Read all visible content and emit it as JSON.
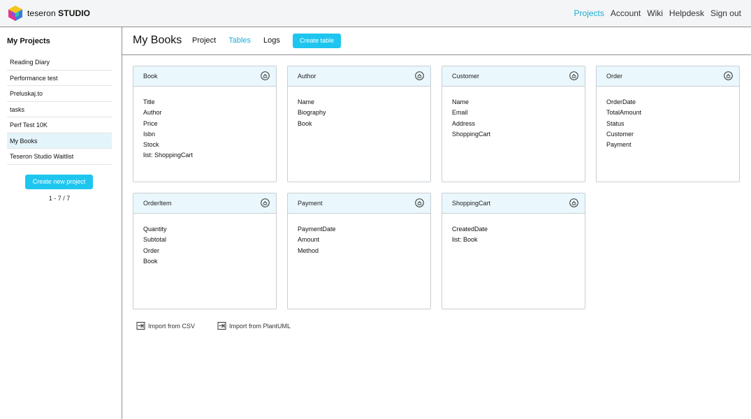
{
  "header": {
    "brand_light": "teseron",
    "brand_bold": "STUDIO",
    "nav": [
      "Projects",
      "Account",
      "Wiki",
      "Helpdesk",
      "Sign out"
    ]
  },
  "sidebar": {
    "title": "My Projects",
    "projects": [
      "Reading Diary",
      "Performance test",
      "Preluskaj.to",
      "tasks",
      "Perf Test 10K",
      "My Books",
      "Teseron Studio Waitlist"
    ],
    "selected": "My Books",
    "create_label": "Create new project",
    "pager": "1 - 7 / 7"
  },
  "main": {
    "title": "My Books",
    "tabs": [
      "Project",
      "Tables",
      "Logs"
    ],
    "active_tab": "Tables",
    "create_table_label": "Create table",
    "tables": [
      {
        "name": "Book",
        "fields": [
          "Title",
          "Author",
          "Price",
          "Isbn",
          "Stock",
          "list: ShoppingCart"
        ]
      },
      {
        "name": "Author",
        "fields": [
          "Name",
          "Biography",
          "Book"
        ]
      },
      {
        "name": "Customer",
        "fields": [
          "Name",
          "Email",
          "Address",
          "ShoppingCart"
        ]
      },
      {
        "name": "Order",
        "fields": [
          "OrderDate",
          "TotalAmount",
          "Status",
          "Customer",
          "Payment"
        ]
      },
      {
        "name": "OrderItem",
        "fields": [
          "Quantity",
          "Subtotal",
          "Order",
          "Book"
        ]
      },
      {
        "name": "Payment",
        "fields": [
          "PaymentDate",
          "Amount",
          "Method"
        ]
      },
      {
        "name": "ShoppingCart",
        "fields": [
          "CreatedDate",
          "list: Book"
        ]
      }
    ],
    "import_csv": "Import from CSV",
    "import_plantuml": "Import from PlantUML"
  },
  "colors": {
    "accent": "#1ec6ef",
    "active_text": "#1aaed6",
    "card_header": "#eaf7fc",
    "selected_row": "#e3f4fb"
  }
}
